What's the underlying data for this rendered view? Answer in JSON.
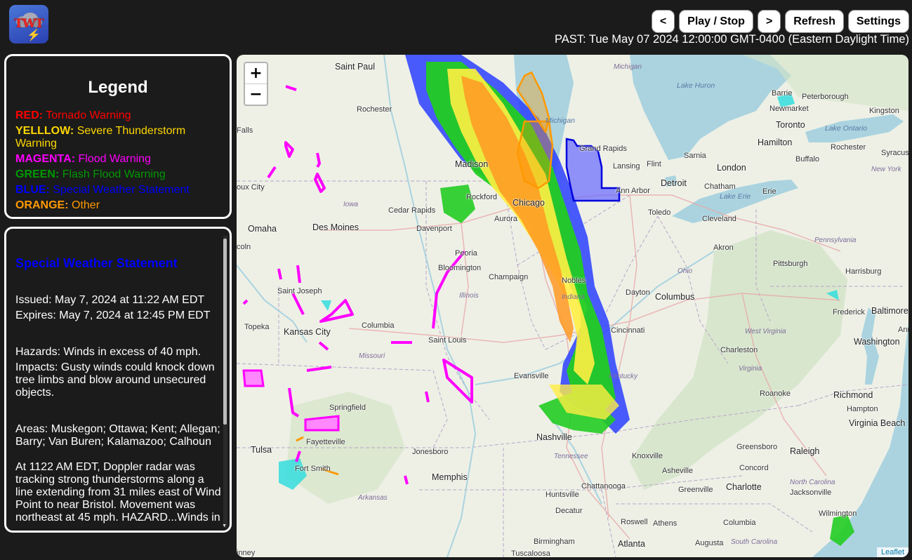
{
  "header": {
    "logo_text": "TWT",
    "buttons": {
      "prev": "<",
      "play_stop": "Play / Stop",
      "next": ">",
      "refresh": "Refresh",
      "settings": "Settings"
    },
    "timestamp": "PAST: Tue May 07 2024 12:00:00 GMT-0400 (Eastern Daylight Time)"
  },
  "legend": {
    "title": "Legend",
    "items": [
      {
        "key": "RED:",
        "label": "Tornado Warning",
        "color": "#ff0000"
      },
      {
        "key": "YELLLOW:",
        "label": "Severe Thunderstorm Warning",
        "color": "#ffd700"
      },
      {
        "key": "MAGENTA:",
        "label": "Flood Warning",
        "color": "#ff00ff"
      },
      {
        "key": "GREEN:",
        "label": "Flash Flood Warning",
        "color": "#009900"
      },
      {
        "key": "BLUE:",
        "label": "Special Weather Statement",
        "color": "#0000ff"
      },
      {
        "key": "ORANGE:",
        "label": "Other",
        "color": "#ff9900"
      }
    ]
  },
  "alert": {
    "title": "Special Weather Statement",
    "issued": "Issued: May 7, 2024 at 11:22 AM EDT",
    "expires": "Expires: May 7, 2024 at 12:45 PM EDT",
    "hazards": "Hazards: Winds in excess of 40 mph.",
    "impacts": "Impacts: Gusty winds could knock down tree limbs and blow around unsecured objects.",
    "areas": "Areas: Muskegon; Ottawa; Kent; Allegan; Barry; Van Buren; Kalamazoo; Calhoun",
    "description": "At 1122 AM EDT, Doppler radar was tracking strong thunderstorms along a line extending from 31 miles east of Wind Point to near Bristol. Movement was northeast at 45 mph. HAZARD...Winds in"
  },
  "map": {
    "zoom_in": "+",
    "zoom_out": "−",
    "attribution": "Leaflet",
    "water": [
      "Lake Huron",
      "Lake Ontario",
      "Lake Erie",
      "Michigan"
    ],
    "states": [
      "Michigan",
      "Iowa",
      "Illinois",
      "Indiana",
      "Ohio",
      "Pennsylvania",
      "Missouri",
      "West Virginia",
      "Virginia",
      "Kentucky",
      "Tennessee",
      "North Carolina",
      "Arkansas",
      "South Carolina",
      "New York"
    ],
    "cities": [
      "Saint Paul",
      "Rochester",
      "Madison",
      "Rockford",
      "Chicago",
      "Aurora",
      "Grand Rapids",
      "Lansing",
      "Flint",
      "Detroit",
      "Ann Arbor",
      "Sarnia",
      "London",
      "Chatham",
      "Barrie",
      "Peterborough",
      "Kingston",
      "Newmarket",
      "Toronto",
      "Hamilton",
      "Rochester",
      "Buffalo",
      "Syracuse",
      "Toledo",
      "Cleveland",
      "Erie",
      "Akron",
      "Pittsburgh",
      "Harrisburg",
      "Dayton",
      "Columbus",
      "Cincinnati",
      "Frederick",
      "Baltimore",
      "Washington",
      "Annap",
      "Charleston",
      "Omaha",
      "Des Moines",
      "Cedar Rapids",
      "Davenport",
      "Peoria",
      "Bloomington",
      "Champaign",
      "Nobles",
      "Saint Joseph",
      "Kansas City",
      "Topeka",
      "Columbia",
      "Saint Louis",
      "Evansville",
      "Springfield",
      "Fayetteville",
      "Fort Smith",
      "Tulsa",
      "Jonesboro",
      "Memphis",
      "Nashville",
      "Knoxville",
      "Greensboro",
      "Roanoke",
      "Richmond",
      "Hampton",
      "Virginia Beach",
      "Raleigh",
      "Concord",
      "Charlotte",
      "Asheville",
      "Greenville",
      "Jacksonville",
      "Wilmington",
      "Columbia",
      "Augusta",
      "Athens",
      "Atlanta",
      "Roswell",
      "Chattanooga",
      "Huntsville",
      "Decatur",
      "Birmingham",
      "Tuscaloosa",
      "Falls",
      "oux City",
      "coln",
      "inney"
    ]
  },
  "colors": {
    "background": "#1b1b1b",
    "flood": "#ff00ff",
    "sws": "#0000ff",
    "other": "#ff9900"
  }
}
